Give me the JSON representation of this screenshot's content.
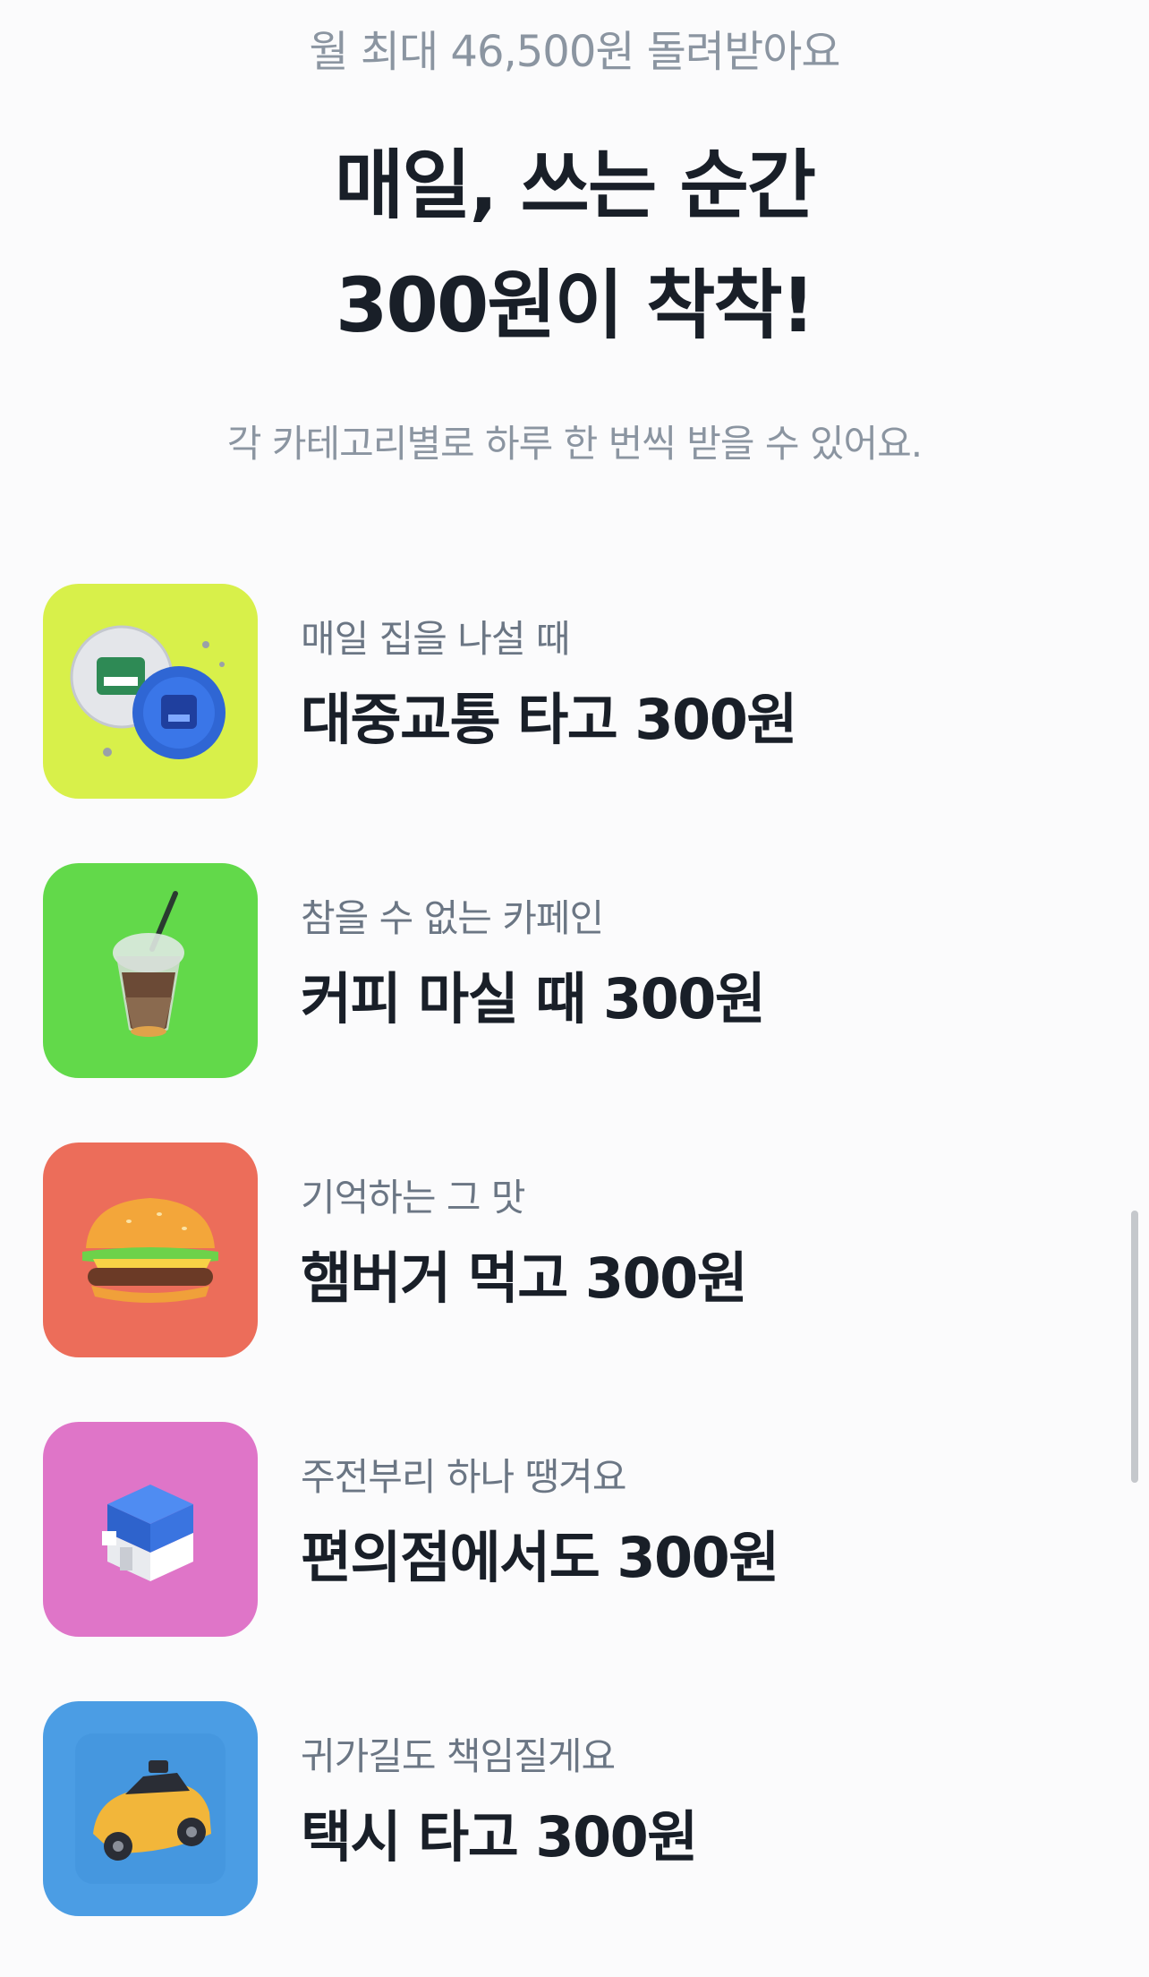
{
  "header": {
    "eyebrow": "월 최대 46,500원 돌려받아요",
    "headline_line1": "매일, 쓰는 순간",
    "headline_line2": "300원이 착착!",
    "subtext": "각 카테고리별로 하루 한 번씩 받을 수 있어요."
  },
  "items": [
    {
      "subtitle": "매일 집을 나설 때",
      "title": "대중교통 타고 300원",
      "icon": "transit-card-icon",
      "bg_color": "#d8f04a"
    },
    {
      "subtitle": "참을 수 없는 카페인",
      "title": "커피 마실 때 300원",
      "icon": "iced-coffee-icon",
      "bg_color": "#62d94a"
    },
    {
      "subtitle": "기억하는 그 맛",
      "title": "햄버거 먹고 300원",
      "icon": "hamburger-icon",
      "bg_color": "#ec6d5a"
    },
    {
      "subtitle": "주전부리 하나 땡겨요",
      "title": "편의점에서도 300원",
      "icon": "convenience-store-icon",
      "bg_color": "#df75c8"
    },
    {
      "subtitle": "귀가길도 책임질게요",
      "title": "택시 타고 300원",
      "icon": "taxi-icon",
      "bg_color": "#4b9de4"
    }
  ]
}
